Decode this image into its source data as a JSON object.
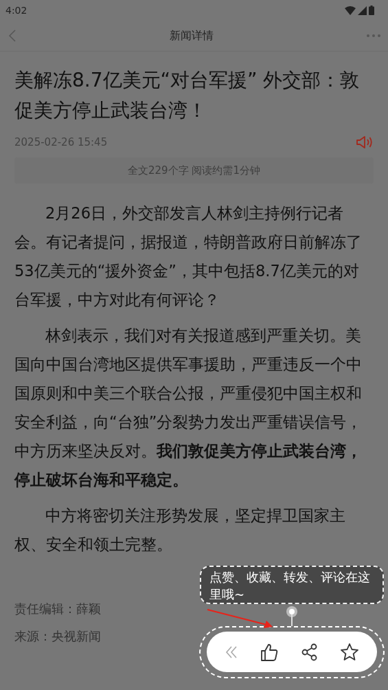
{
  "status_bar": {
    "time": "4:02"
  },
  "nav": {
    "title": "新闻详情"
  },
  "article": {
    "headline": "美解冻8.7亿美元“对台军援” 外交部：敦促美方停止武装台湾！",
    "date": "2025-02-26 15:45",
    "reading_info": "全文229个字 阅读约需1分钟",
    "paragraphs": [
      "2月26日，外交部发言人林剑主持例行记者会。有记者提问，据报道，特朗普政府日前解冻了53亿美元的“援外资金”，其中包括8.7亿美元的对台军援，中方对此有何评论？",
      "林剑表示，我们对有关报道感到严重关切。美国向中国台湾地区提供军事援助，严重违反一个中国原则和中美三个联合公报，严重侵犯中国主权和安全利益，向“台独”分裂势力发出严重错误信号，中方历来坚决反对。**我们敦促美方停止武装台湾，停止破坏台海和平稳定。**",
      "中方将密切关注形势发展，坚定捍卫国家主权、安全和领土完整。"
    ],
    "editor": "责任编辑：薛颖",
    "source": "来源：央视新闻"
  },
  "guide": {
    "tip": "点赞、收藏、转发、评论在这里哦~"
  }
}
